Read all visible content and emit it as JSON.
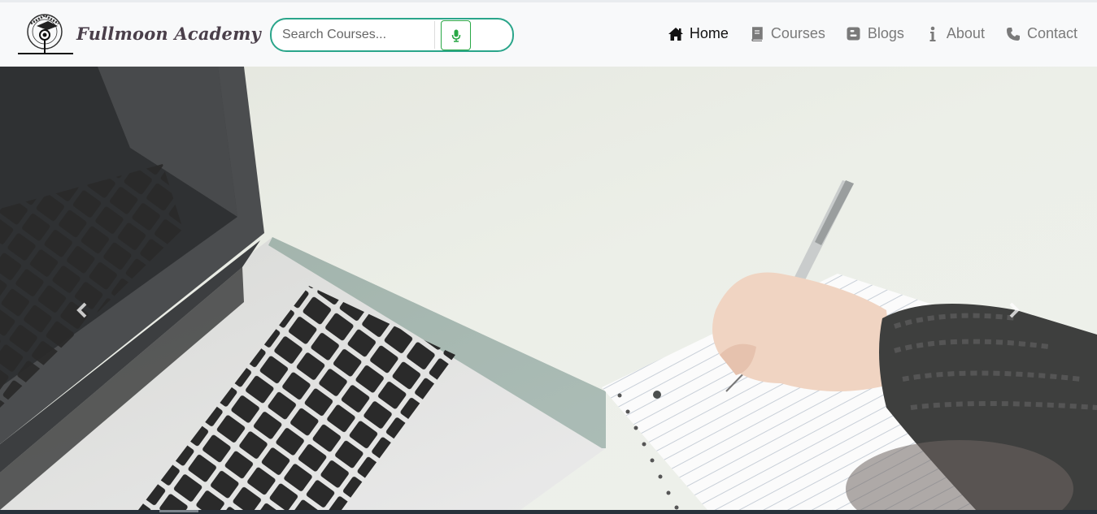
{
  "brand": {
    "name": "Fullmoon Academy",
    "logo_icon": "graduation-cap-owl-logo",
    "logo_ring_text": "THE LEARNING PEOPLE"
  },
  "search": {
    "placeholder": "Search Courses...",
    "value": "",
    "voice_icon": "microphone-icon",
    "accent_color": "#2aa58a"
  },
  "nav": {
    "items": [
      {
        "label": "Home",
        "icon": "home-icon",
        "active": true
      },
      {
        "label": "Courses",
        "icon": "book-icon",
        "active": false
      },
      {
        "label": "Blogs",
        "icon": "blogger-icon",
        "active": false
      },
      {
        "label": "About",
        "icon": "info-icon",
        "active": false
      },
      {
        "label": "Contact",
        "icon": "phone-icon",
        "active": false
      }
    ]
  },
  "carousel": {
    "slide": "laptop and hand writing in notebook",
    "prev_icon": "chevron-left-icon",
    "next_icon": "chevron-right-icon",
    "active_indicator": 1
  },
  "colors": {
    "navbar_bg": "#f8f9fa",
    "active_text": "#111111",
    "inactive_text": "#7a7a7a",
    "mic_green": "#28a745"
  }
}
